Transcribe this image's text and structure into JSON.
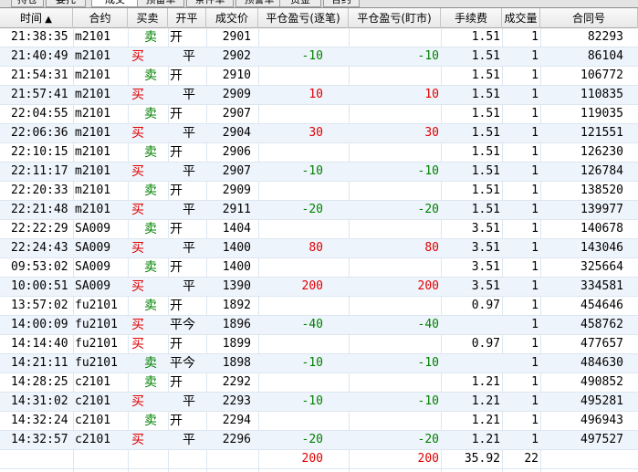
{
  "tabs": [
    "持仓",
    "委托",
    "成交",
    "预备单",
    "条件单",
    "预警单",
    "资金",
    "合约"
  ],
  "active_tab": 2,
  "columns": [
    "时间",
    "合约",
    "买卖",
    "开平",
    "成交价",
    "平仓盈亏(逐笔)",
    "平仓盈亏(盯市)",
    "手续费",
    "成交量",
    "合同号"
  ],
  "sort_arrow": "▲",
  "rows": [
    [
      "21:38:35",
      "m2101",
      "卖",
      "开",
      "2901",
      "",
      "",
      "1.51",
      "1",
      "82293"
    ],
    [
      "21:40:49",
      "m2101",
      "买",
      "平",
      "2902",
      "-10",
      "-10",
      "1.51",
      "1",
      "86104"
    ],
    [
      "21:54:31",
      "m2101",
      "卖",
      "开",
      "2910",
      "",
      "",
      "1.51",
      "1",
      "106772"
    ],
    [
      "21:57:41",
      "m2101",
      "买",
      "平",
      "2909",
      "10",
      "10",
      "1.51",
      "1",
      "110835"
    ],
    [
      "22:04:55",
      "m2101",
      "卖",
      "开",
      "2907",
      "",
      "",
      "1.51",
      "1",
      "119035"
    ],
    [
      "22:06:36",
      "m2101",
      "买",
      "平",
      "2904",
      "30",
      "30",
      "1.51",
      "1",
      "121551"
    ],
    [
      "22:10:15",
      "m2101",
      "卖",
      "开",
      "2906",
      "",
      "",
      "1.51",
      "1",
      "126230"
    ],
    [
      "22:11:17",
      "m2101",
      "买",
      "平",
      "2907",
      "-10",
      "-10",
      "1.51",
      "1",
      "126784"
    ],
    [
      "22:20:33",
      "m2101",
      "卖",
      "开",
      "2909",
      "",
      "",
      "1.51",
      "1",
      "138520"
    ],
    [
      "22:21:48",
      "m2101",
      "买",
      "平",
      "2911",
      "-20",
      "-20",
      "1.51",
      "1",
      "139977"
    ],
    [
      "22:22:29",
      "SA009",
      "卖",
      "开",
      "1404",
      "",
      "",
      "3.51",
      "1",
      "140678"
    ],
    [
      "22:24:43",
      "SA009",
      "买",
      "平",
      "1400",
      "80",
      "80",
      "3.51",
      "1",
      "143046"
    ],
    [
      "09:53:02",
      "SA009",
      "卖",
      "开",
      "1400",
      "",
      "",
      "3.51",
      "1",
      "325664"
    ],
    [
      "10:00:51",
      "SA009",
      "买",
      "平",
      "1390",
      "200",
      "200",
      "3.51",
      "1",
      "334581"
    ],
    [
      "13:57:02",
      "fu2101",
      "卖",
      "开",
      "1892",
      "",
      "",
      "0.97",
      "1",
      "454646"
    ],
    [
      "14:00:09",
      "fu2101",
      "买",
      "平今",
      "1896",
      "-40",
      "-40",
      "",
      "1",
      "458762"
    ],
    [
      "14:14:40",
      "fu2101",
      "买",
      "开",
      "1899",
      "",
      "",
      "0.97",
      "1",
      "477657"
    ],
    [
      "14:21:11",
      "fu2101",
      "卖",
      "平今",
      "1898",
      "-10",
      "-10",
      "",
      "1",
      "484630"
    ],
    [
      "14:28:25",
      "c2101",
      "卖",
      "开",
      "2292",
      "",
      "",
      "1.21",
      "1",
      "490852"
    ],
    [
      "14:31:02",
      "c2101",
      "买",
      "平",
      "2293",
      "-10",
      "-10",
      "1.21",
      "1",
      "495281"
    ],
    [
      "14:32:24",
      "c2101",
      "卖",
      "开",
      "2294",
      "",
      "",
      "1.21",
      "1",
      "496943"
    ],
    [
      "14:32:57",
      "c2101",
      "买",
      "平",
      "2296",
      "-20",
      "-20",
      "1.21",
      "1",
      "497527"
    ]
  ],
  "totals": [
    "",
    "",
    "",
    "",
    "",
    "200",
    "200",
    "35.92",
    "22",
    ""
  ],
  "colors": {
    "buy": "#e00000",
    "sell": "#008000",
    "row_alt": "#eef4fb"
  }
}
